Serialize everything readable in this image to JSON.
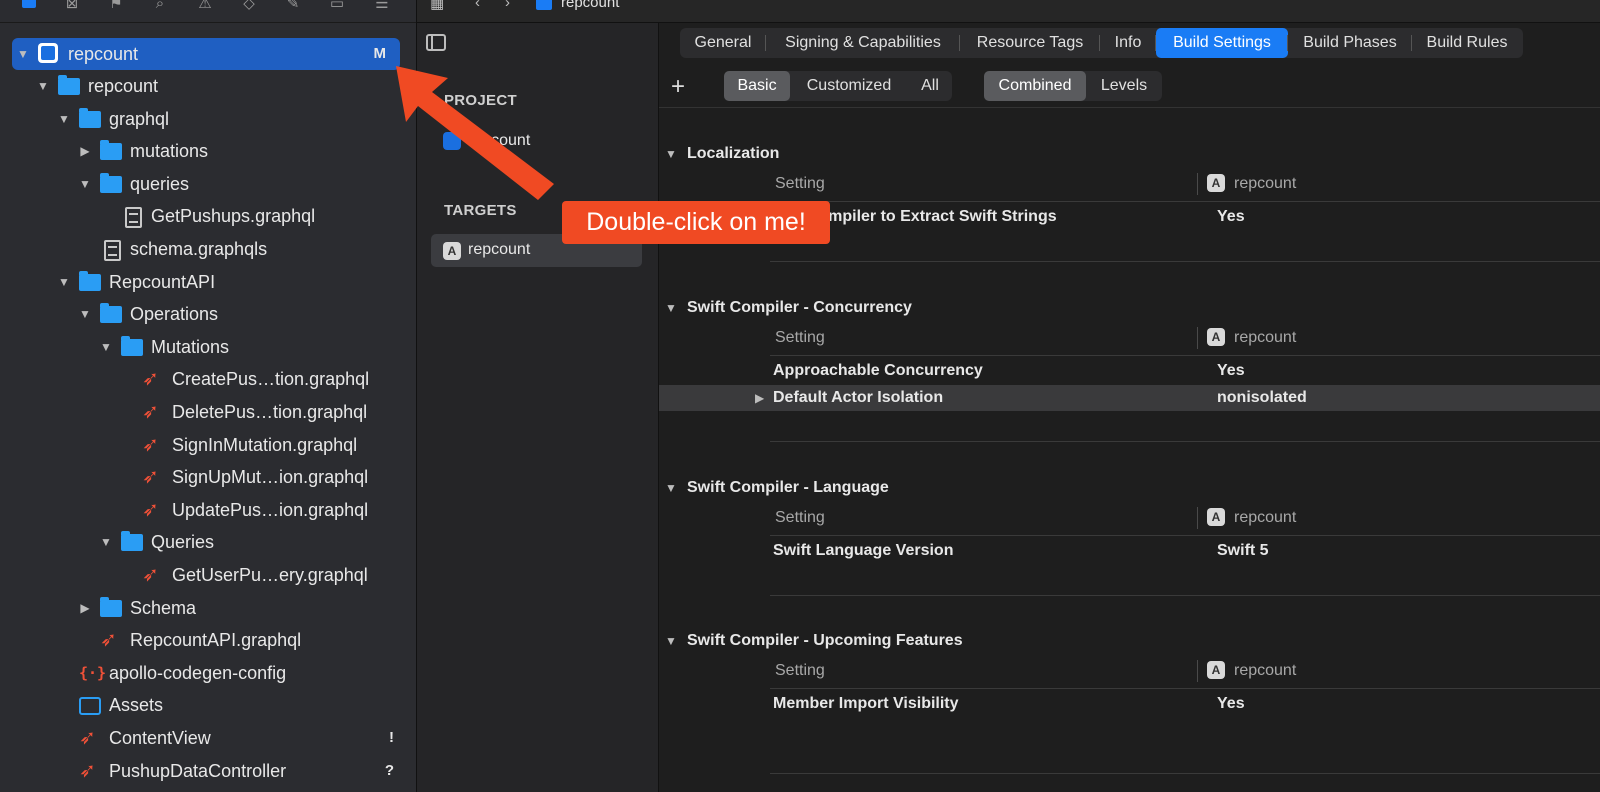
{
  "navigator": {
    "project": {
      "name": "repcount",
      "badge": "M"
    },
    "items": [
      {
        "name": "repcount",
        "kind": "folder",
        "indent": 1,
        "open": true
      },
      {
        "name": "graphql",
        "kind": "folder",
        "indent": 2,
        "open": true
      },
      {
        "name": "mutations",
        "kind": "folder",
        "indent": 3,
        "open": false
      },
      {
        "name": "queries",
        "kind": "folder",
        "indent": 3,
        "open": true
      },
      {
        "name": "GetPushups.graphql",
        "kind": "doc",
        "indent": 4
      },
      {
        "name": "schema.graphqls",
        "kind": "doc",
        "indent": 3
      },
      {
        "name": "RepcountAPI",
        "kind": "folder",
        "indent": 2,
        "open": true
      },
      {
        "name": "Operations",
        "kind": "folder",
        "indent": 3,
        "open": true
      },
      {
        "name": "Mutations",
        "kind": "folder",
        "indent": 4,
        "open": true
      },
      {
        "name": "CreatePus…tion.graphql",
        "kind": "swift",
        "indent": 5
      },
      {
        "name": "DeletePus…tion.graphql",
        "kind": "swift",
        "indent": 5
      },
      {
        "name": "SignInMutation.graphql",
        "kind": "swift",
        "indent": 5
      },
      {
        "name": "SignUpMut…ion.graphql",
        "kind": "swift",
        "indent": 5
      },
      {
        "name": "UpdatePus…ion.graphql",
        "kind": "swift",
        "indent": 5
      },
      {
        "name": "Queries",
        "kind": "folder",
        "indent": 4,
        "open": true
      },
      {
        "name": "GetUserPu…ery.graphql",
        "kind": "swift",
        "indent": 5
      },
      {
        "name": "Schema",
        "kind": "folder",
        "indent": 3,
        "open": false
      },
      {
        "name": "RepcountAPI.graphql",
        "kind": "swift",
        "indent": 3
      },
      {
        "name": "apollo-codegen-config",
        "kind": "json",
        "indent": 2
      },
      {
        "name": "Assets",
        "kind": "assets",
        "indent": 2
      },
      {
        "name": "ContentView",
        "kind": "swift",
        "indent": 2,
        "badge": "!"
      },
      {
        "name": "PushupDataController",
        "kind": "swift",
        "indent": 2,
        "badge": "?"
      }
    ]
  },
  "breadcrumb": {
    "current": "repcount"
  },
  "project_list": {
    "project_header": "PROJECT",
    "project_item": "repcount",
    "targets_header": "TARGETS",
    "target_item": "repcount"
  },
  "tabs": [
    "General",
    "Signing & Capabilities",
    "Resource Tags",
    "Info",
    "Build Settings",
    "Build Phases",
    "Build Rules"
  ],
  "active_tab": "Build Settings",
  "filters": {
    "plus": "+",
    "scope": [
      "Basic",
      "Customized",
      "All"
    ],
    "scope_active": "Basic",
    "view": [
      "Combined",
      "Levels"
    ],
    "view_active": "Combined"
  },
  "groups": [
    {
      "title": "Localization",
      "setting_header": "Setting",
      "target_header": "repcount",
      "rows": [
        {
          "name": "Use Compiler to Extract Swift Strings",
          "value": "Yes"
        }
      ]
    },
    {
      "title": "Swift Compiler - Concurrency",
      "setting_header": "Setting",
      "target_header": "repcount",
      "rows": [
        {
          "name": "Approachable Concurrency",
          "value": "Yes"
        },
        {
          "name": "Default Actor Isolation",
          "value": "nonisolated",
          "expandable": true,
          "highlighted": true
        }
      ]
    },
    {
      "title": "Swift Compiler - Language",
      "setting_header": "Setting",
      "target_header": "repcount",
      "rows": [
        {
          "name": "Swift Language Version",
          "value": "Swift 5"
        }
      ]
    },
    {
      "title": "Swift Compiler - Upcoming Features",
      "setting_header": "Setting",
      "target_header": "repcount",
      "rows": [
        {
          "name": "Member Import Visibility",
          "value": "Yes"
        }
      ]
    }
  ],
  "annotation": {
    "text": "Double-click on me!",
    "color": "#f04a23"
  },
  "colors": {
    "accent": "#1a7cf5",
    "selection": "#1f5fc2",
    "sidebar_bg": "#2b2c30",
    "editor_bg": "#1e1e1e"
  },
  "icons": [
    "navigator-icon",
    "source-control-icon",
    "bookmark-icon",
    "search-icon",
    "warning-icon",
    "test-icon",
    "debug-icon",
    "breakpoint-icon",
    "report-icon"
  ]
}
